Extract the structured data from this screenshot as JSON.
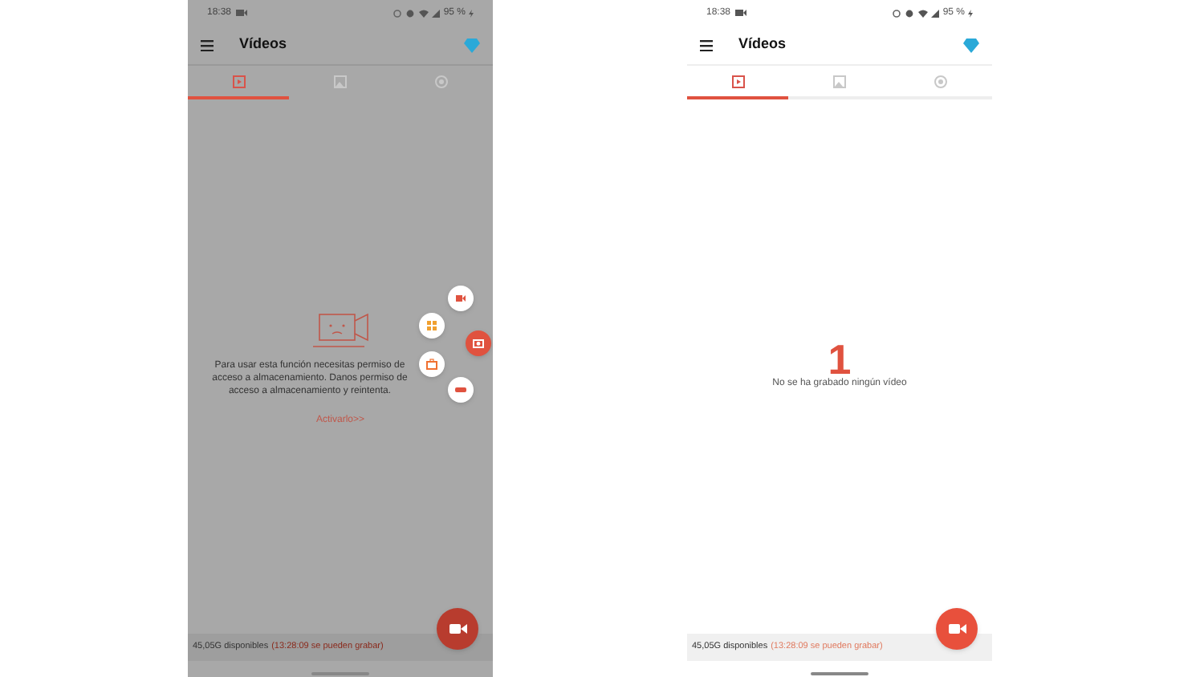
{
  "screens": [
    {
      "kind": "permission",
      "dimmed": true,
      "status_bar": {
        "time": "18:38",
        "battery": "95 %"
      },
      "title": "Vídeos",
      "tabs": [
        {
          "selected": true
        },
        {
          "selected": false
        },
        {
          "selected": false
        }
      ],
      "message": "Para usar esta función necesitas permiso de acceso a almacenamiento. Danos permiso de acceso a almacenamiento y reintenta.",
      "action": "Activarlo>>",
      "speed_dial": {
        "open": true
      },
      "footer": {
        "storage": "45,05G disponibles",
        "time": "(13:28:09 se pueden grabar)"
      }
    },
    {
      "kind": "empty",
      "dimmed": false,
      "status_bar": {
        "time": "18:38",
        "battery": "95 %"
      },
      "title": "Vídeos",
      "tabs": [
        {
          "selected": true
        },
        {
          "selected": false
        },
        {
          "selected": false
        }
      ],
      "annotation": "1",
      "message": "No se ha grabado ningún vídeo",
      "footer": {
        "storage": "45,05G disponibles",
        "time": "(13:28:09 se pueden grabar)"
      }
    }
  ]
}
